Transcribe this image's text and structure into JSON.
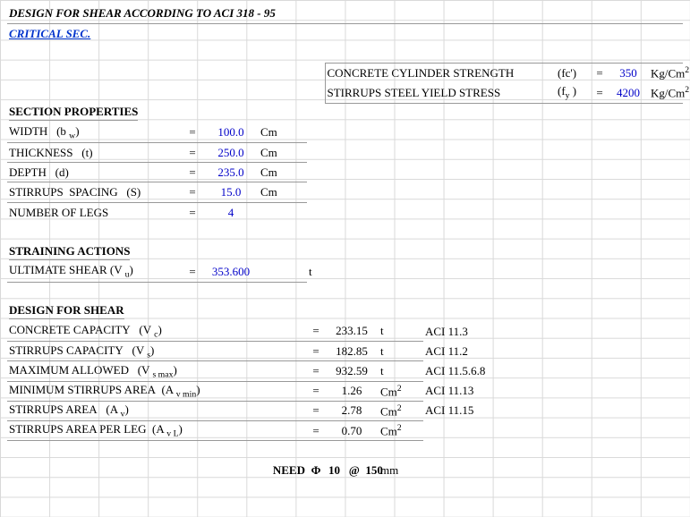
{
  "title": "DESIGN FOR SHEAR ACCORDING TO ACI 318 - 95",
  "subtitle": "CRITICAL SEC.",
  "materials": {
    "fc_label": "CONCRETE CYLINDER STRENGTH",
    "fc_sym": "(fc')",
    "fc_eq": "=",
    "fc_value": "350",
    "fc_unit_html": "Kg/Cm²",
    "fy_label": "STIRRUPS STEEL YIELD STRESS",
    "fy_sym_html": "(f<sub>y</sub> )",
    "fy_eq": "=",
    "fy_value": "4200",
    "fy_unit_html": "Kg/Cm²"
  },
  "section_properties": {
    "heading": "SECTION PROPERTIES",
    "rows": [
      {
        "label_html": "WIDTH&nbsp;&nbsp;&nbsp;(b <sub>w</sub>)",
        "eq": "=",
        "value": "100.0",
        "unit": "Cm"
      },
      {
        "label_html": "THICKNESS&nbsp;&nbsp;&nbsp;(t)",
        "eq": "=",
        "value": "250.0",
        "unit": "Cm"
      },
      {
        "label_html": "DEPTH&nbsp;&nbsp;&nbsp;(d)",
        "eq": "=",
        "value": "235.0",
        "unit": "Cm"
      },
      {
        "label_html": "STIRRUPS&nbsp;&nbsp;SPACING&nbsp;&nbsp;&nbsp;(S)",
        "eq": "=",
        "value": "15.0",
        "unit": "Cm"
      },
      {
        "label_html": "NUMBER OF LEGS",
        "eq": "=",
        "value": "4",
        "unit": ""
      }
    ]
  },
  "straining_actions": {
    "heading": "STRAINING ACTIONS",
    "rows": [
      {
        "label_html": "ULTIMATE SHEAR (V <sub>u</sub>)",
        "eq": "=",
        "value": "353.600",
        "unit": "t"
      }
    ]
  },
  "design_for_shear": {
    "heading": "DESIGN FOR SHEAR",
    "rows": [
      {
        "label_html": "CONCRETE CAPACITY&nbsp;&nbsp;&nbsp;(V <sub>c</sub>)",
        "eq": "=",
        "value": "233.15",
        "unit_html": "t",
        "ref": "ACI 11.3"
      },
      {
        "label_html": "STIRRUPS CAPACITY&nbsp;&nbsp;&nbsp;(V <sub>s</sub>)",
        "eq": "=",
        "value": "182.85",
        "unit_html": "t",
        "ref": "ACI 11.2"
      },
      {
        "label_html": "MAXIMUM ALLOWED&nbsp;&nbsp;&nbsp;(V <sub>s max</sub>)",
        "eq": "=",
        "value": "932.59",
        "unit_html": "t",
        "ref": "ACI 11.5.6.8"
      },
      {
        "label_html": "MINIMUM STIRRUPS AREA&nbsp;&nbsp;(A <sub>v min</sub>)",
        "eq": "=",
        "value": "1.26",
        "unit_html": "Cm<sup>2</sup>",
        "ref": "ACI 11.13"
      },
      {
        "label_html": "STIRRUPS AREA&nbsp;&nbsp;&nbsp;(A <sub>v</sub>)",
        "eq": "=",
        "value": "2.78",
        "unit_html": "Cm<sup>2</sup>",
        "ref": "ACI 11.15"
      },
      {
        "label_html": "STIRRUPS AREA PER LEG&nbsp;&nbsp;(A <sub>v L</sub>)",
        "eq": "=",
        "value": "0.70",
        "unit_html": "Cm<sup>2</sup>",
        "ref": ""
      }
    ]
  },
  "need": {
    "label": "NEED",
    "phi": "Φ",
    "dia": "10",
    "at": "@",
    "spacing": "150",
    "unit": "mm"
  }
}
